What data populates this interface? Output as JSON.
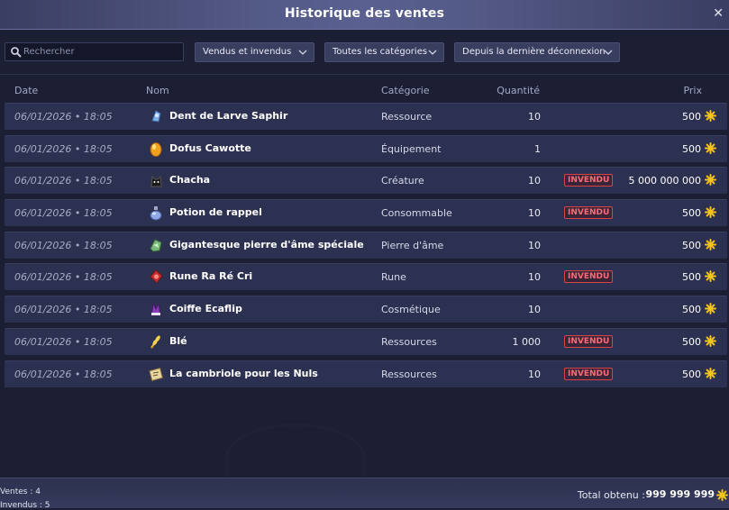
{
  "window": {
    "title": "Historique des ventes",
    "close_glyph": "✕"
  },
  "toolbar": {
    "search_placeholder": "Rechercher",
    "filter_status": "Vendus et invendus",
    "filter_category": "Toutes les catégories",
    "filter_time": "Depuis la dernière déconnexion"
  },
  "columns": {
    "date": "Date",
    "name": "Nom",
    "category": "Catégorie",
    "quantity": "Quantité",
    "price": "Prix"
  },
  "rows": [
    {
      "date": "06/01/2026 • 18:05",
      "icon": "sapphire-tooth-icon",
      "name": "Dent de Larve Saphir",
      "category": "Ressource",
      "quantity": "10",
      "status": "",
      "price": "500"
    },
    {
      "date": "06/01/2026 • 18:05",
      "icon": "dofus-egg-icon",
      "name": "Dofus Cawotte",
      "category": "Équipement",
      "quantity": "1",
      "status": "",
      "price": "500"
    },
    {
      "date": "06/01/2026 • 18:05",
      "icon": "cat-creature-icon",
      "name": "Chacha",
      "category": "Créature",
      "quantity": "10",
      "status": "INVENDU",
      "price": "5 000 000 000"
    },
    {
      "date": "06/01/2026 • 18:05",
      "icon": "potion-icon",
      "name": "Potion de rappel",
      "category": "Consommable",
      "quantity": "10",
      "status": "INVENDU",
      "price": "500"
    },
    {
      "date": "06/01/2026 • 18:05",
      "icon": "soul-stone-icon",
      "name": "Gigantesque pierre d'âme spéciale",
      "category": "Pierre d'âme",
      "quantity": "10",
      "status": "",
      "price": "500"
    },
    {
      "date": "06/01/2026 • 18:05",
      "icon": "rune-icon",
      "name": "Rune Ra Ré Cri",
      "category": "Rune",
      "quantity": "10",
      "status": "INVENDU",
      "price": "500"
    },
    {
      "date": "06/01/2026 • 18:05",
      "icon": "ecaflip-hat-icon",
      "name": "Coiffe Ecaflip",
      "category": "Cosmétique",
      "quantity": "10",
      "status": "",
      "price": "500"
    },
    {
      "date": "06/01/2026 • 18:05",
      "icon": "wheat-icon",
      "name": "Blé",
      "category": "Ressources",
      "quantity": "1 000",
      "status": "INVENDU",
      "price": "500"
    },
    {
      "date": "06/01/2026 • 18:05",
      "icon": "scroll-map-icon",
      "name": "La cambriole pour les Nuls",
      "category": "Ressources",
      "quantity": "10",
      "status": "INVENDU",
      "price": "500"
    }
  ],
  "footer": {
    "sales": "Ventes : 4",
    "unsold": "Invendus : 5",
    "total_label": "Total obtenu :",
    "total_value": "999 999 999"
  },
  "colors": {
    "accent_gold": "#f5c518",
    "badge_red": "#d8434a",
    "row_bg": "#2d3151",
    "panel_bg": "#1c1f33"
  }
}
